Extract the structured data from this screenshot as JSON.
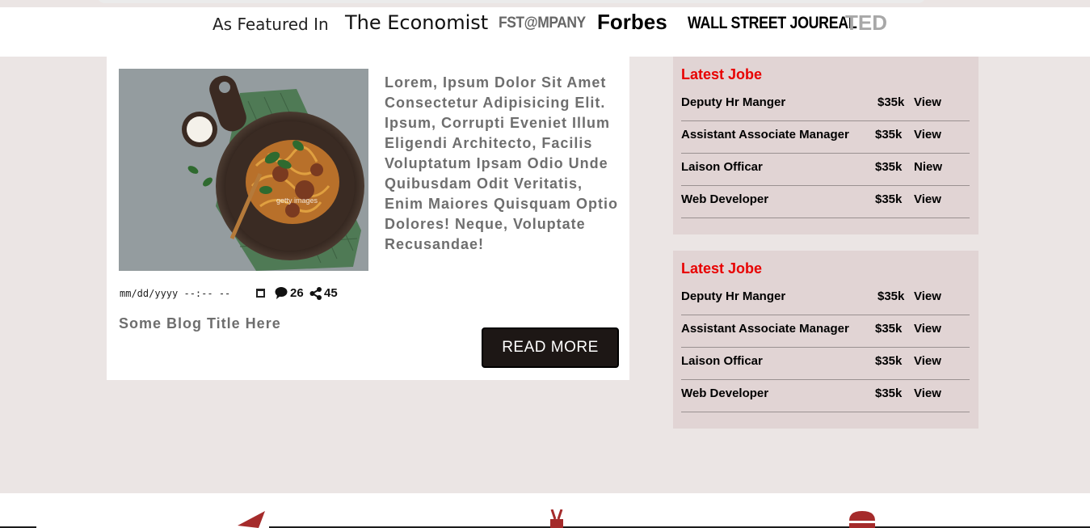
{
  "featured": {
    "label": "As Featured In",
    "logos": [
      "The Economist",
      "FST@MPANY",
      "Forbes",
      "WALL STREET JOUREAL",
      "TED"
    ]
  },
  "blog": {
    "image_icon": "pasta-dish-photo",
    "excerpt": "Lorem, Ipsum Dolor Sit Amet Consectetur Adipisicing Elit. Ipsum, Corrupti Eveniet Illum Eligendi Architecto, Facilis Voluptatum Ipsam Odio Unde Quibusdam Odit Veritatis, Enim Maiores Quisquam Optio Dolores! Neque, Voluptate Recusandae!",
    "date_placeholder": "mm/dd/yyyy --:-- --",
    "comments": "26",
    "shares": "45",
    "title": "Some Blog Title Here",
    "read_more": "READ MORE"
  },
  "jobs_panels": [
    {
      "title": "Latest Jobe",
      "rows": [
        {
          "title": "Deputy Hr Manger",
          "salary": "$35k",
          "action": "View"
        },
        {
          "title": "Assistant Associate Manager",
          "salary": "$35k",
          "action": "View"
        },
        {
          "title": "Laison Officar",
          "salary": "$35k",
          "action": "Niew"
        },
        {
          "title": "Web Developer",
          "salary": "$35k",
          "action": "View"
        }
      ]
    },
    {
      "title": "Latest Jobe",
      "rows": [
        {
          "title": "Deputy Hr Manger",
          "salary": "$35k",
          "action": "View"
        },
        {
          "title": "Assistant Associate Manager",
          "salary": "$35k",
          "action": "View"
        },
        {
          "title": "Laison Officar",
          "salary": "$35k",
          "action": "View"
        },
        {
          "title": "Web Developer",
          "salary": "$35k",
          "action": "View"
        }
      ]
    }
  ],
  "footer_icons": [
    "paper-plane-icon",
    "peace-hand-icon",
    "burger-icon"
  ],
  "colors": {
    "accent_red": "#e80000",
    "icon_red": "#a52b2b",
    "button_dark": "#1d1715",
    "page_bg": "#ebe5e4",
    "panel_bg": "#e1d4d4"
  }
}
